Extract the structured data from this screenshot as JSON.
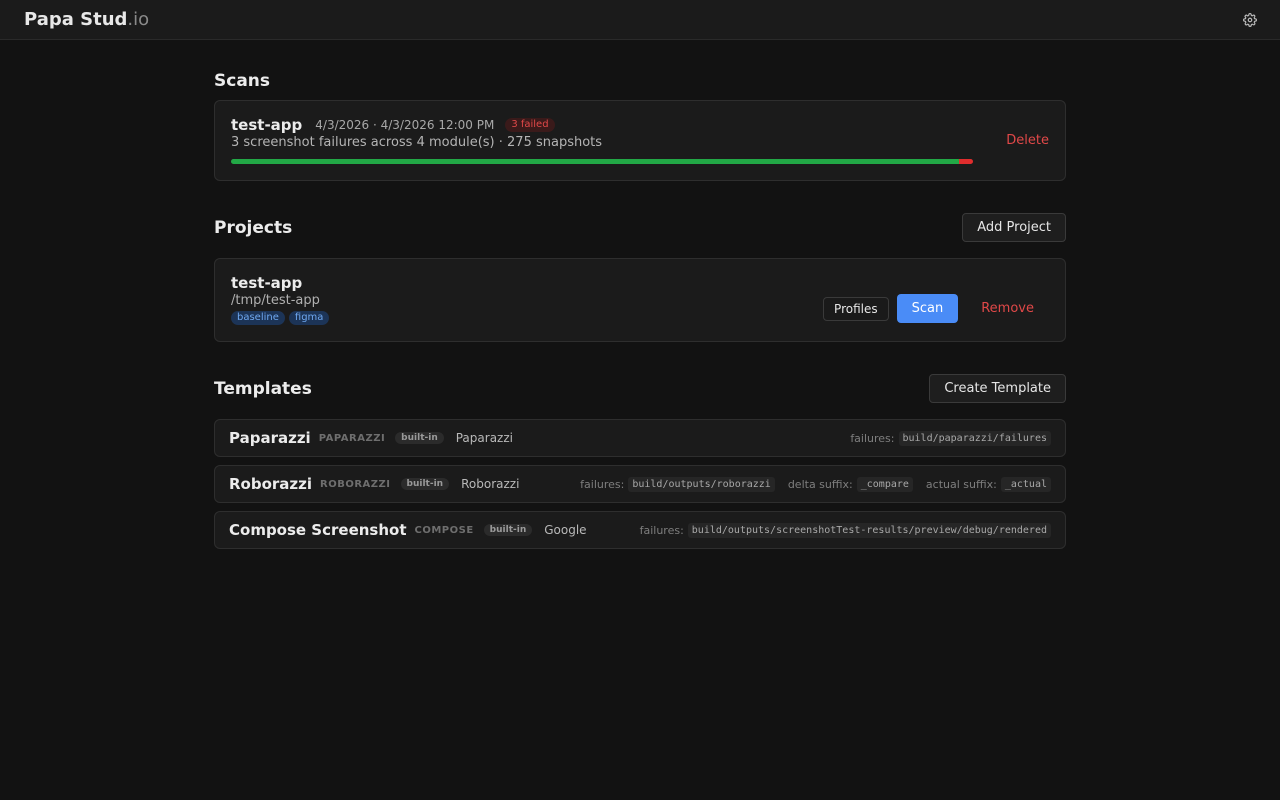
{
  "header": {
    "brand": "Papa Stud",
    "brand_suffix": ".io",
    "settings_icon": "gear-icon"
  },
  "scans": {
    "title": "Scans",
    "items": [
      {
        "name": "test-app",
        "date": "4/3/2026 · 4/3/2026 12:00 PM",
        "failed_badge": "3 failed",
        "summary": "3 screenshot failures across 4 module(s) · 275 snapshots",
        "progress_passed_fraction": 0.981,
        "delete_label": "Delete"
      }
    ]
  },
  "projects": {
    "title": "Projects",
    "add_label": "Add Project",
    "items": [
      {
        "name": "test-app",
        "path": "/tmp/test-app",
        "tags": [
          "baseline",
          "figma"
        ],
        "profiles_label": "Profiles",
        "scan_label": "Scan",
        "remove_label": "Remove"
      }
    ]
  },
  "templates": {
    "title": "Templates",
    "create_label": "Create Template",
    "items": [
      {
        "name": "Paparazzi",
        "code": "PAPARAZZI",
        "badge": "built-in",
        "vendor": "Paparazzi",
        "meta": [
          {
            "label": "failures:",
            "value": "build/paparazzi/failures"
          }
        ]
      },
      {
        "name": "Roborazzi",
        "code": "ROBORAZZI",
        "badge": "built-in",
        "vendor": "Roborazzi",
        "meta": [
          {
            "label": "failures:",
            "value": "build/outputs/roborazzi"
          },
          {
            "label": "delta suffix:",
            "value": "_compare"
          },
          {
            "label": "actual suffix:",
            "value": "_actual"
          }
        ]
      },
      {
        "name": "Compose Screenshot",
        "code": "COMPOSE",
        "badge": "built-in",
        "vendor": "Google",
        "meta": [
          {
            "label": "failures:",
            "value": "build/outputs/screenshotTest-results/preview/debug/rendered"
          }
        ]
      }
    ]
  },
  "colors": {
    "accent": "#4a8cf7",
    "danger": "#e04848",
    "success": "#22a846"
  }
}
